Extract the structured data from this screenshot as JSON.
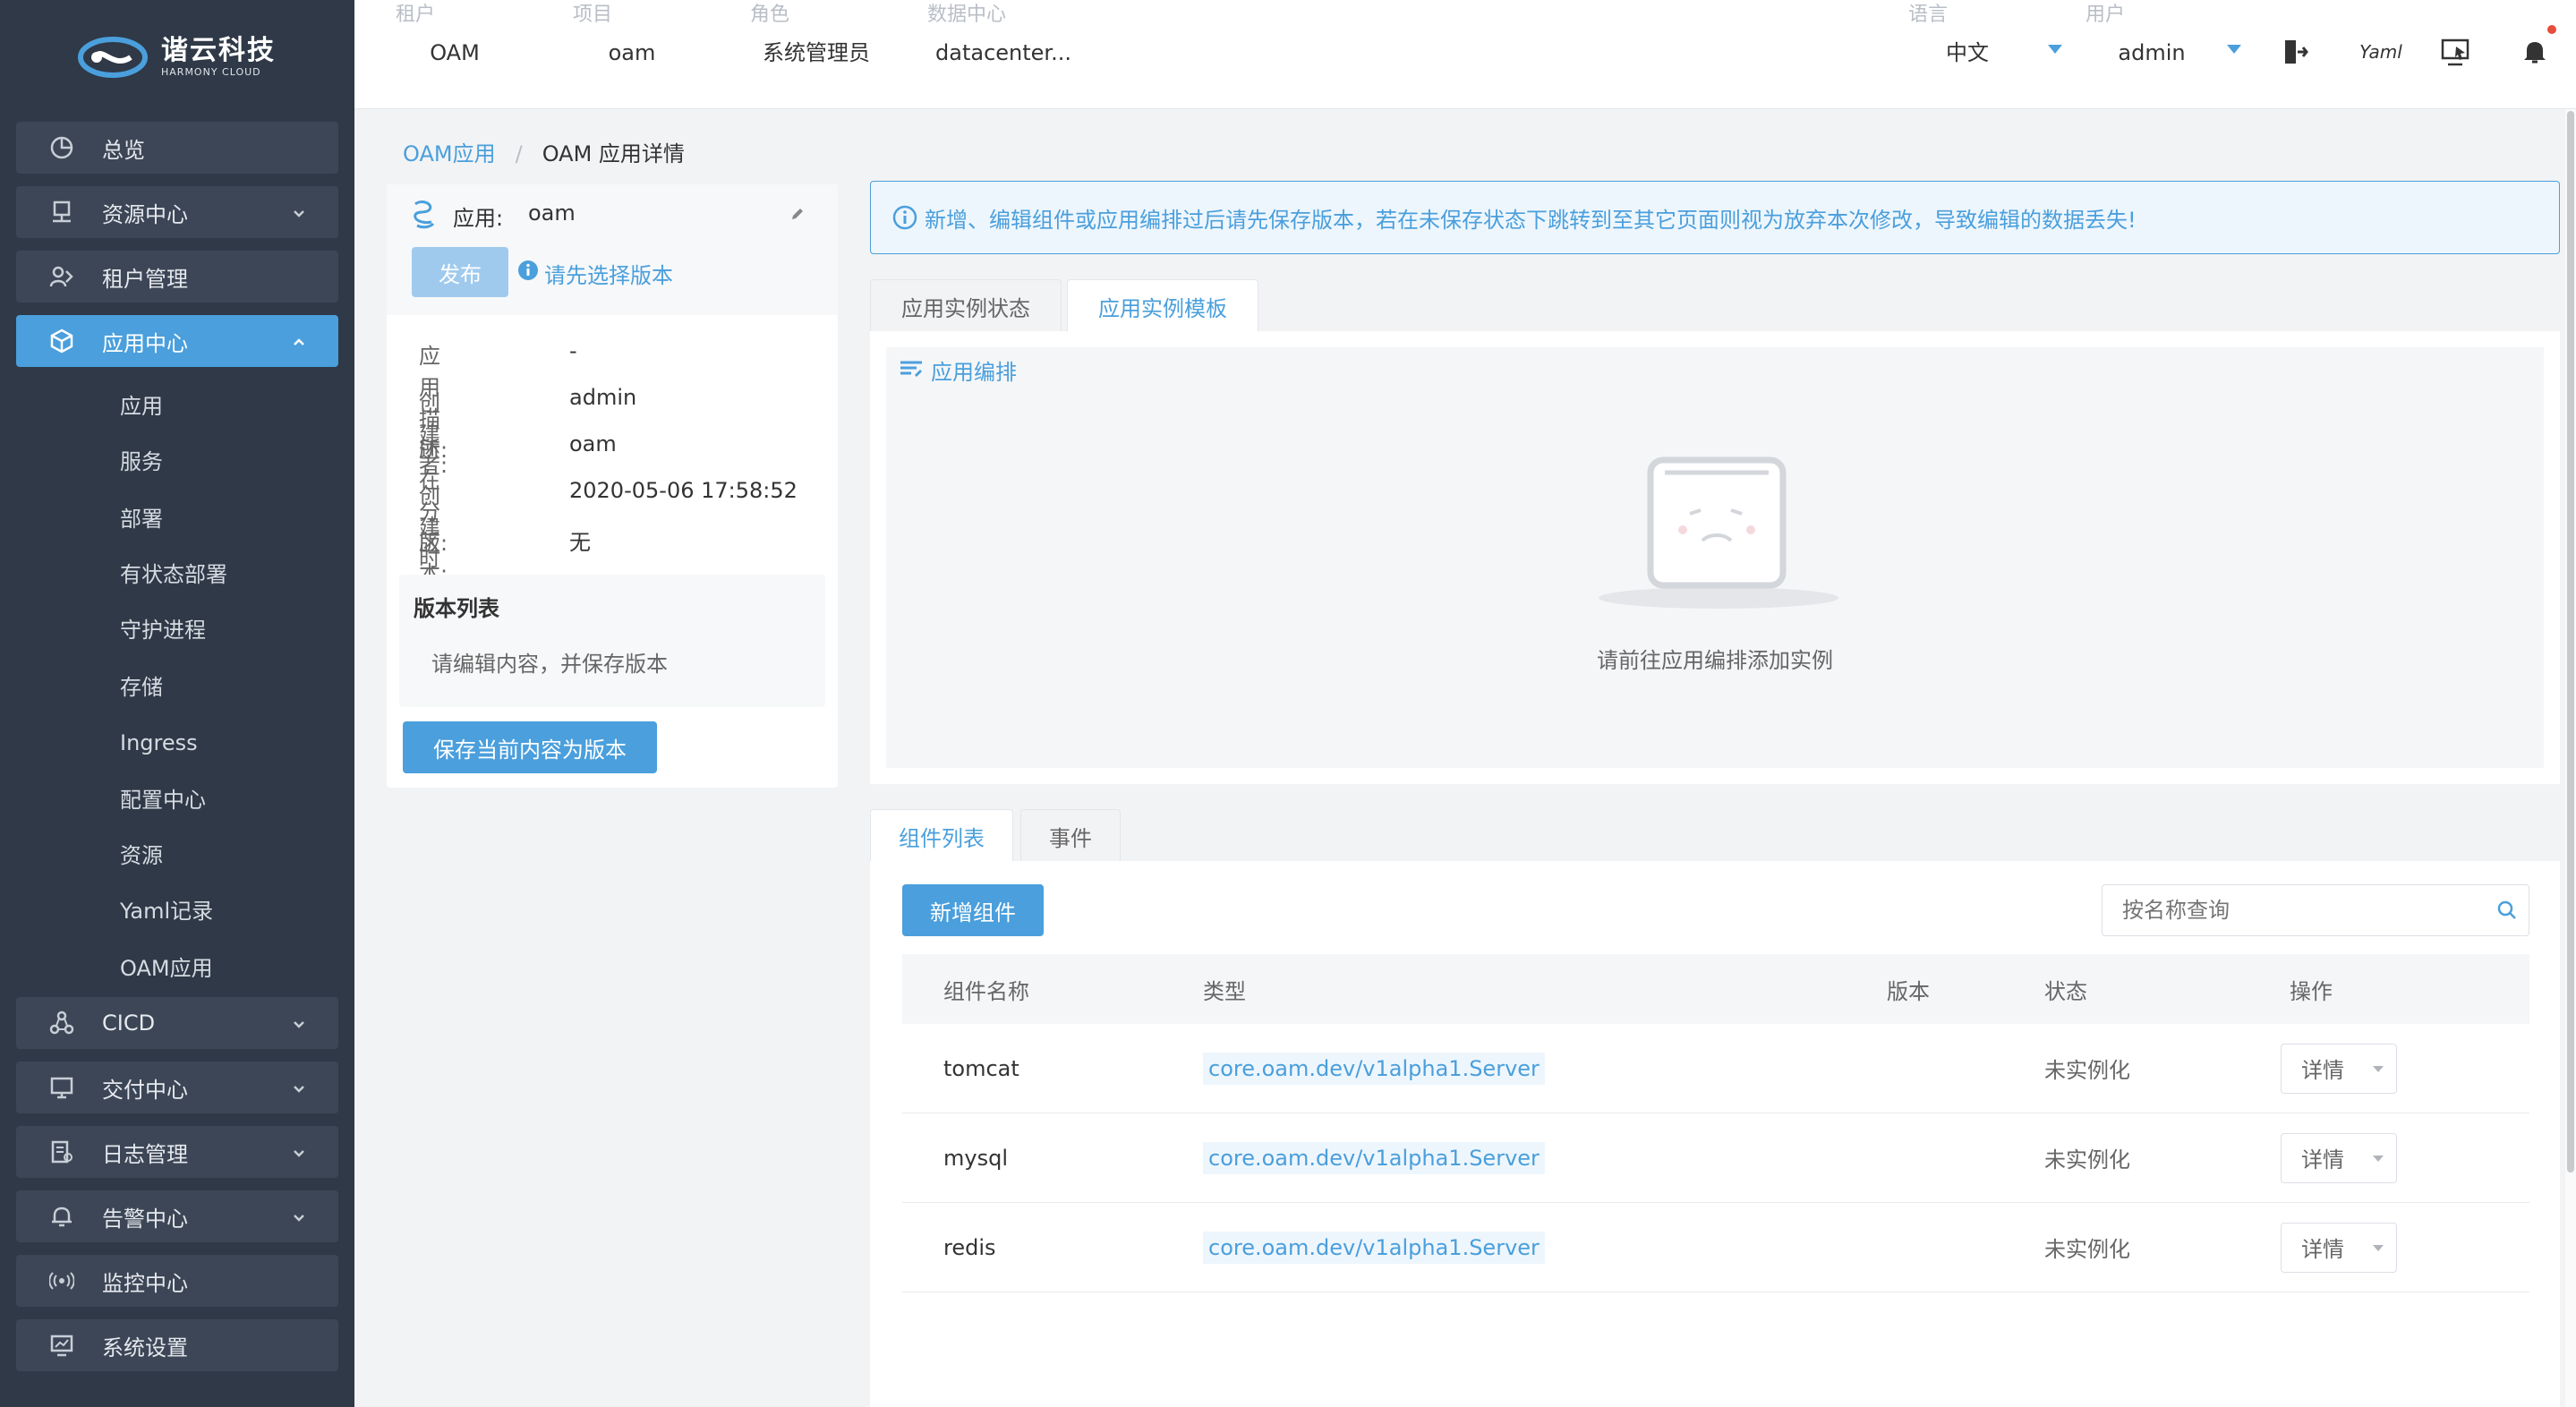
{
  "brand": {
    "name_cn": "谐云科技",
    "name_en": "HARMONY CLOUD"
  },
  "sidebar": {
    "items": [
      {
        "label": "总览",
        "icon": "pie-chart-icon",
        "expandable": false
      },
      {
        "label": "资源中心",
        "icon": "server-icon",
        "expandable": true
      },
      {
        "label": "租户管理",
        "icon": "users-icon",
        "expandable": false
      },
      {
        "label": "应用中心",
        "icon": "cube-icon",
        "expandable": true,
        "active": true
      },
      {
        "label": "CICD",
        "icon": "workflow-icon",
        "expandable": true
      },
      {
        "label": "交付中心",
        "icon": "monitor-icon",
        "expandable": true
      },
      {
        "label": "日志管理",
        "icon": "log-icon",
        "expandable": true
      },
      {
        "label": "告警中心",
        "icon": "bell-icon",
        "expandable": true
      },
      {
        "label": "监控中心",
        "icon": "broadcast-icon",
        "expandable": false
      },
      {
        "label": "系统设置",
        "icon": "chart-screen-icon",
        "expandable": false
      }
    ],
    "subitems": [
      "应用",
      "服务",
      "部署",
      "有状态部署",
      "守护进程",
      "存储",
      "Ingress",
      "配置中心",
      "资源",
      "Yaml记录",
      "OAM应用"
    ]
  },
  "topbar": {
    "tenant": {
      "label": "租户",
      "value": "OAM"
    },
    "project": {
      "label": "项目",
      "value": "oam"
    },
    "role": {
      "label": "角色",
      "value": "系统管理员"
    },
    "datacenter": {
      "label": "数据中心",
      "value": "datacenter..."
    },
    "language": {
      "label": "语言",
      "value": "中文"
    },
    "user": {
      "label": "用户",
      "value": "admin"
    },
    "yaml_icon_text": "Yaml"
  },
  "breadcrumb": {
    "parent": "OAM应用",
    "separator": "/",
    "current": "OAM 应用详情"
  },
  "app_card": {
    "app_label": "应用:",
    "app_name": "oam",
    "publish_label": "发布",
    "hint": "请先选择版本",
    "info": [
      {
        "key": "应用描述:",
        "value": "-"
      },
      {
        "key": "创建者:",
        "value": "admin"
      },
      {
        "key": "所在分区:",
        "value": "oam"
      },
      {
        "key": "创建时间:",
        "value": "2020-05-06 17:58:52"
      },
      {
        "key": "版本:",
        "value": "无"
      }
    ],
    "version_list_title": "版本列表",
    "version_list_empty": "请编辑内容，并保存版本",
    "save_button": "保存当前内容为版本"
  },
  "notice": "新增、编辑组件或应用编排过后请先保存版本，若在未保存状态下跳转到至其它页面则视为放弃本次修改，导致编辑的数据丢失!",
  "top_tabs": [
    {
      "label": "应用实例状态",
      "active": false
    },
    {
      "label": "应用实例模板",
      "active": true
    }
  ],
  "orchestration_link": "应用编排",
  "empty_text": "请前往应用编排添加实例",
  "bottom_tabs": [
    {
      "label": "组件列表",
      "active": true
    },
    {
      "label": "事件",
      "active": false
    }
  ],
  "components": {
    "add_button": "新增组件",
    "search_placeholder": "按名称查询",
    "headers": [
      "组件名称",
      "类型",
      "版本",
      "状态",
      "操作"
    ],
    "rows": [
      {
        "name": "tomcat",
        "type": "core.oam.dev/v1alpha1.Server",
        "version": "",
        "status": "未实例化",
        "action": "详情"
      },
      {
        "name": "mysql",
        "type": "core.oam.dev/v1alpha1.Server",
        "version": "",
        "status": "未实例化",
        "action": "详情"
      },
      {
        "name": "redis",
        "type": "core.oam.dev/v1alpha1.Server",
        "version": "",
        "status": "未实例化",
        "action": "详情"
      }
    ]
  },
  "colors": {
    "accent": "#4a9fdc",
    "sidebar_bg": "#2f3947",
    "sidebar_item": "#3c4656"
  }
}
